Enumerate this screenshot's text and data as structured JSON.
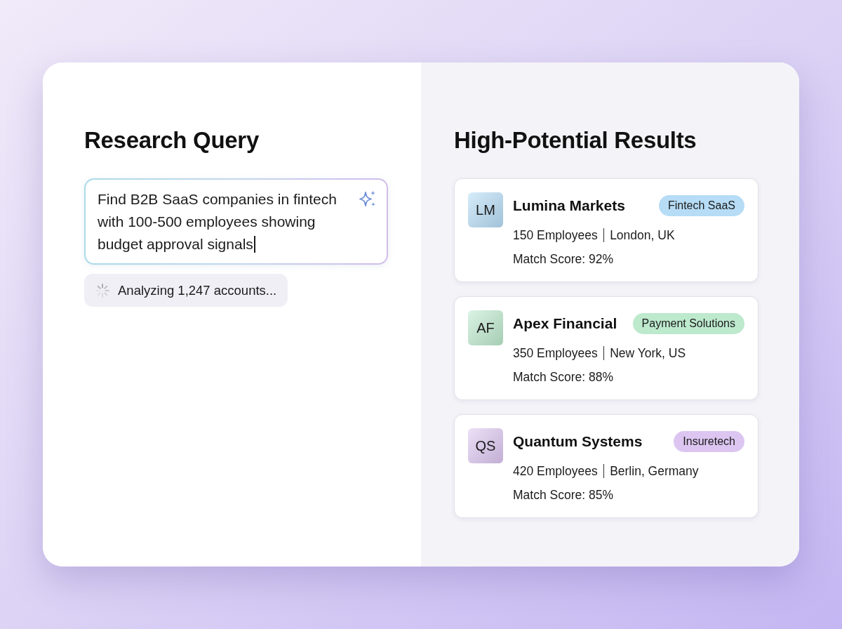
{
  "query_panel": {
    "title": "Research Query",
    "query": {
      "value": "Find B2B SaaS companies in fintech with 100-500 employees showing budget approval signals",
      "focused": true
    },
    "status": {
      "text": "Analyzing 1,247 accounts...",
      "loading": true
    }
  },
  "results_panel": {
    "title": "High-Potential Results",
    "results": [
      {
        "initials": "LM",
        "name": "Lumina Markets",
        "tag": "Fintech SaaS",
        "color": "#b6dcf6",
        "employees": "150 Employees",
        "location": "London, UK",
        "match": "Match Score: 92%"
      },
      {
        "initials": "AF",
        "name": "Apex Financial",
        "tag": "Payment Solutions",
        "color": "#bde9cd",
        "employees": "350 Employees",
        "location": "New York, US",
        "match": "Match Score: 88%"
      },
      {
        "initials": "QS",
        "name": "Quantum Systems",
        "tag": "Insuretech",
        "color": "#dcc6f1",
        "employees": "420 Employees",
        "location": "Berlin, Germany",
        "match": "Match Score: 85%"
      }
    ]
  }
}
